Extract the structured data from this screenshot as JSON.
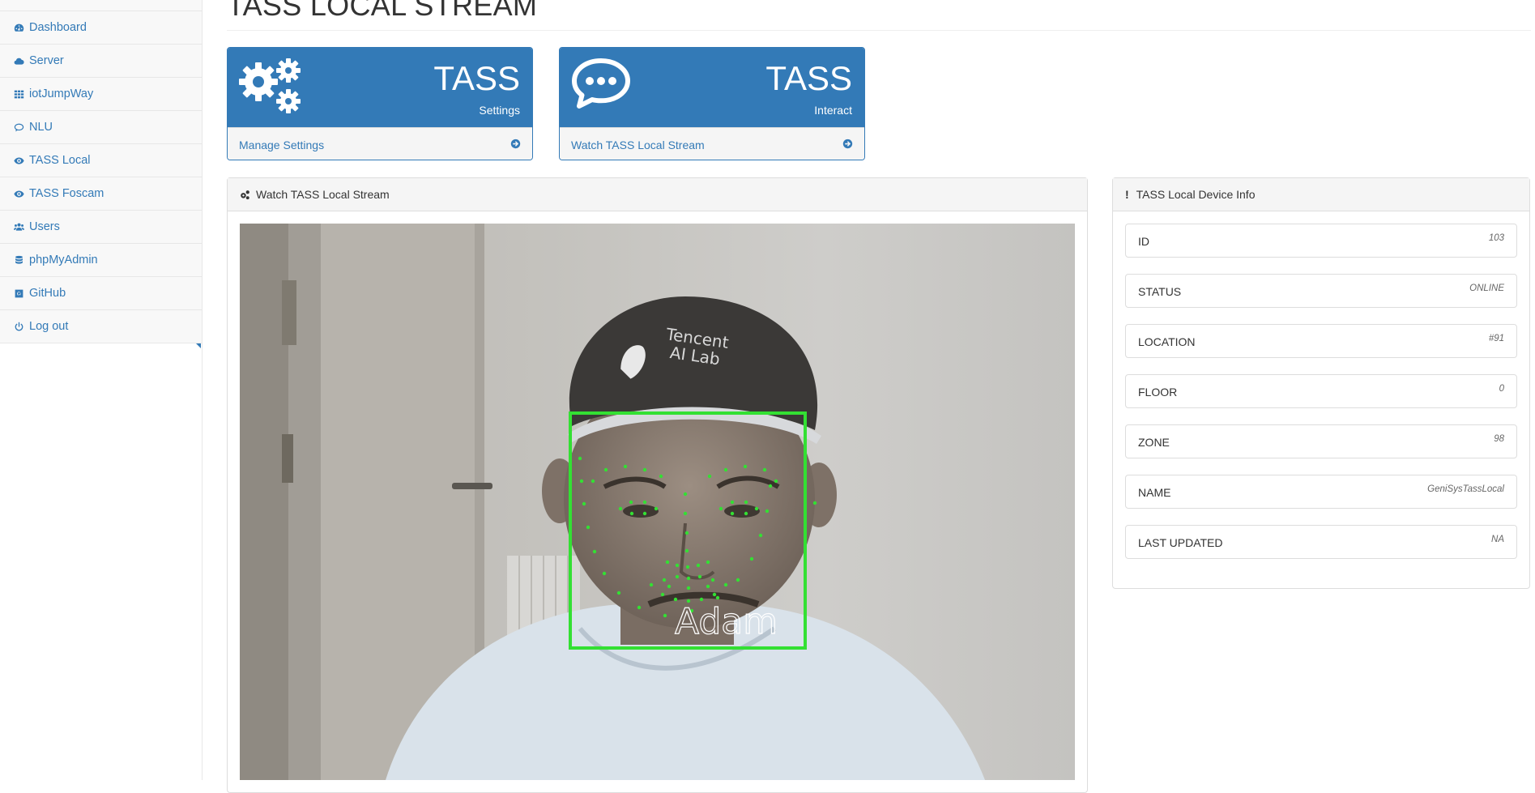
{
  "sidebar": {
    "items": [
      {
        "label": "Dashboard",
        "icon": "dashboard-icon"
      },
      {
        "label": "Server",
        "icon": "cloud-icon"
      },
      {
        "label": "iotJumpWay",
        "icon": "grid-icon"
      },
      {
        "label": "NLU",
        "icon": "speech-bubble-icon"
      },
      {
        "label": "TASS Local",
        "icon": "eye-icon"
      },
      {
        "label": "TASS Foscam",
        "icon": "eye-icon"
      },
      {
        "label": "Users",
        "icon": "users-icon"
      },
      {
        "label": "phpMyAdmin",
        "icon": "database-icon"
      },
      {
        "label": "GitHub",
        "icon": "github-icon"
      },
      {
        "label": "Log out",
        "icon": "power-icon"
      }
    ]
  },
  "page": {
    "title": "TASS LOCAL STREAM"
  },
  "cards": [
    {
      "title": "TASS",
      "subtitle": "Settings",
      "link": "Manage Settings",
      "icon": "gears-icon"
    },
    {
      "title": "TASS",
      "subtitle": "Interact",
      "link": "Watch TASS Local Stream",
      "icon": "comments-icon"
    }
  ],
  "stream": {
    "heading": "Watch TASS Local Stream",
    "detected_name": "Adam",
    "cap_text_line1": "Tencent",
    "cap_text_line2": "AI Lab"
  },
  "device_info": {
    "heading": "TASS Local Device Info",
    "rows": [
      {
        "label": "ID",
        "value": "103"
      },
      {
        "label": "STATUS",
        "value": "ONLINE"
      },
      {
        "label": "LOCATION",
        "value": "#91"
      },
      {
        "label": "FLOOR",
        "value": "0"
      },
      {
        "label": "ZONE",
        "value": "98"
      },
      {
        "label": "NAME",
        "value": "GeniSysTassLocal"
      },
      {
        "label": "LAST UPDATED",
        "value": "NA"
      }
    ]
  },
  "colors": {
    "primary": "#337ab7",
    "box": "#33e033"
  }
}
